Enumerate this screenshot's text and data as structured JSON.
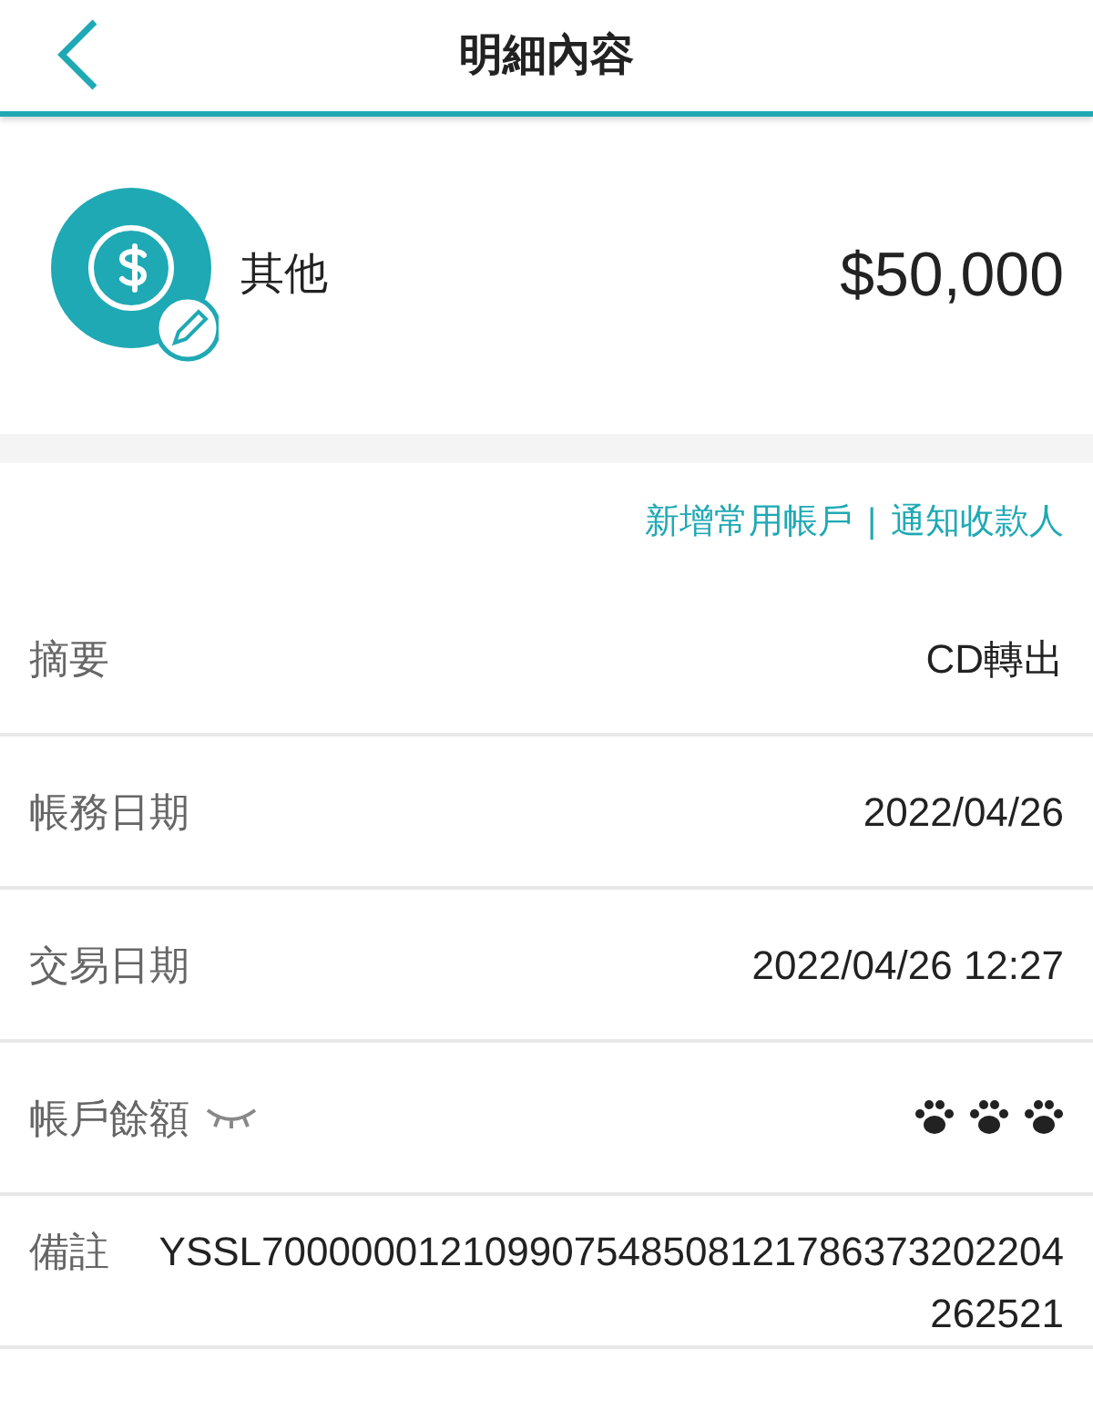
{
  "header": {
    "title": "明細內容"
  },
  "summary": {
    "category": "其他",
    "amount": "$50,000"
  },
  "links": [
    "新增常用帳戶",
    "通知收款人"
  ],
  "link_separator": "|",
  "rows": [
    {
      "kind": "text",
      "label": "摘要",
      "value": "CD轉出"
    },
    {
      "kind": "text",
      "label": "帳務日期",
      "value": "2022/04/26"
    },
    {
      "kind": "text",
      "label": "交易日期",
      "value": "2022/04/26 12:27"
    },
    {
      "kind": "masked",
      "label": "帳戶餘額"
    },
    {
      "kind": "memo",
      "label": "備註",
      "value": "YSSL700000012109907548508121786373202204262521"
    }
  ]
}
